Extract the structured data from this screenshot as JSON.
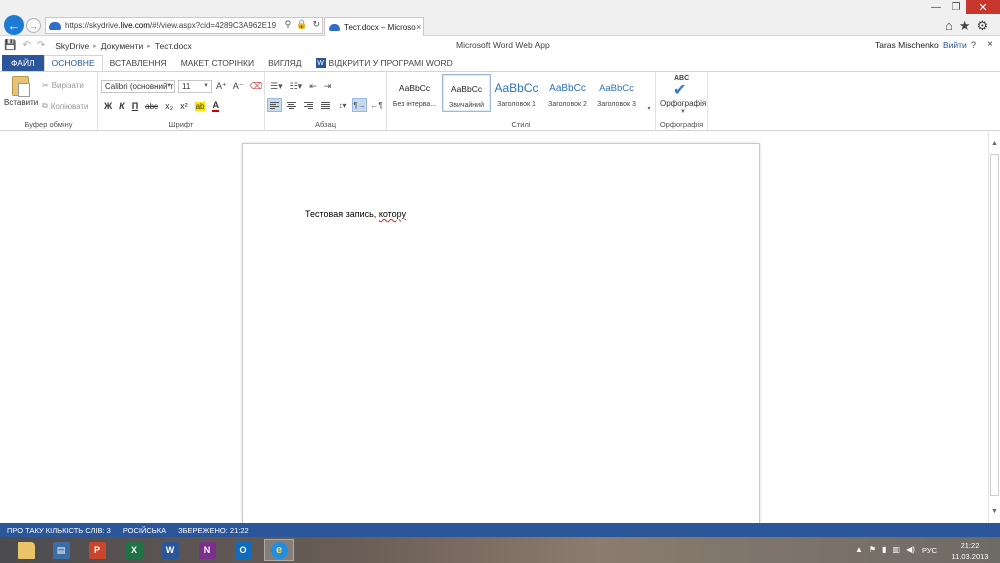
{
  "browser": {
    "url_prefix": "https://skydrive.",
    "url_domain": "live.com",
    "url_rest": "/#!/view.aspx?cid=4289C3A962E19",
    "tab_title": "Тест.docx – Microso...",
    "tab_close": "×"
  },
  "word_header": {
    "breadcrumb": [
      "SkyDrive",
      "Документи",
      "Тест.docx"
    ],
    "app_title": "Microsoft Word Web App",
    "user_name": "Taras Mischenko",
    "sign_out": "Вийти",
    "help": "?",
    "close": "×"
  },
  "ribbon_tabs": [
    {
      "label": "ФАЙЛ"
    },
    {
      "label": "ОСНОВНЕ"
    },
    {
      "label": "ВСТАВЛЕННЯ"
    },
    {
      "label": "МАКЕТ СТОРІНКИ"
    },
    {
      "label": "ВИГЛЯД"
    },
    {
      "label": "ВІДКРИТИ У ПРОГРАМІ WORD"
    }
  ],
  "clipboard": {
    "paste": "Вставити",
    "cut": "Вирізати",
    "copy": "Копіювати",
    "group": "Буфер обміну"
  },
  "font": {
    "name": "Calibri (основний т",
    "size": "11",
    "group": "Шрифт",
    "bold": "Ж",
    "italic": "К",
    "underline": "П",
    "strike": "abc",
    "subscript": "x₂",
    "superscript": "x²",
    "highlight": "ab",
    "color": "A",
    "grow": "A⁺",
    "shrink": "A⁻"
  },
  "paragraph": {
    "group": "Абзац"
  },
  "styles": {
    "group": "Стилі",
    "items": [
      {
        "sample": "AaBbCc",
        "name": "Без інтерва..."
      },
      {
        "sample": "AaBbCc",
        "name": "Звичайний"
      },
      {
        "sample": "AaBbCc",
        "name": "Заголовок 1"
      },
      {
        "sample": "AaBbCc",
        "name": "Заголовок 2"
      },
      {
        "sample": "AaBbCc",
        "name": "Заголовок 3"
      }
    ]
  },
  "proofing": {
    "abc": "ABC",
    "label": "Орфографія",
    "group": "Орфографія"
  },
  "document": {
    "text_before": "Тестовая запись, ",
    "text_misspelled": "котору"
  },
  "statusbar": {
    "word_count": "ПРО ТАКУ КІЛЬКІСТЬ СЛІВ: 3",
    "language": "РОСІЙСЬКА",
    "saved": "ЗБЕРЕЖЕНО: 21:22"
  },
  "taskbar": {
    "apps": [
      "file-explorer",
      "presentation",
      "powerpoint",
      "excel",
      "word",
      "onenote",
      "outlook",
      "internet-explorer"
    ],
    "lang": "РУС",
    "time": "21:22",
    "date": "11.03.2013"
  },
  "colors": {
    "accent": "#2b579a",
    "close_red": "#c7372e",
    "spell_red": "#e02020"
  }
}
